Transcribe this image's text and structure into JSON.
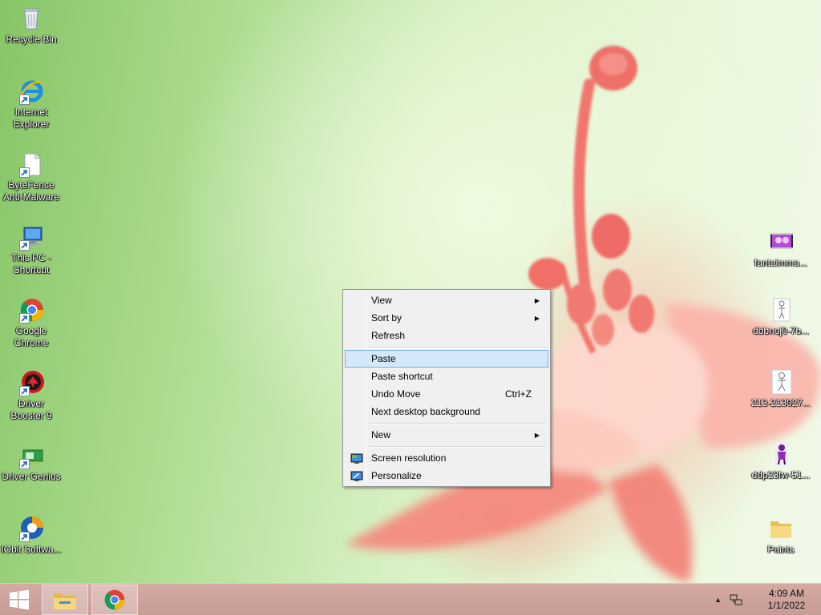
{
  "desktop": {
    "left_icons": [
      {
        "name": "recycle-bin",
        "label": "Recycle Bin",
        "icon": "recycle-bin-icon"
      },
      {
        "name": "internet-explorer",
        "label": "Internet Explorer",
        "icon": "internet-explorer-icon"
      },
      {
        "name": "bytefence",
        "label": "ByteFence Anti-Malware",
        "icon": "bytefence-icon"
      },
      {
        "name": "this-pc",
        "label": "This PC - Shortcut",
        "icon": "computer-icon"
      },
      {
        "name": "google-chrome",
        "label": "Google Chrome",
        "icon": "chrome-icon"
      },
      {
        "name": "driver-booster",
        "label": "Driver Booster 9",
        "icon": "driver-booster-icon"
      },
      {
        "name": "driver-genius",
        "label": "Driver Genius",
        "icon": "driver-genius-icon"
      },
      {
        "name": "iobit-software",
        "label": "IObit Softwa...",
        "icon": "iobit-icon"
      }
    ],
    "right_icons": [
      {
        "name": "fantaimma",
        "label": "fantaimma...",
        "icon": "image-file-icon"
      },
      {
        "name": "dbbnoj",
        "label": "dbbnoj0-7b...",
        "icon": "image-file-icon"
      },
      {
        "name": "213",
        "label": "213-213027...",
        "icon": "image-file-icon"
      },
      {
        "name": "ddp23fw",
        "label": "ddp23fw-51...",
        "icon": "image-file-icon"
      },
      {
        "name": "paints",
        "label": "Paints",
        "icon": "folder-icon"
      }
    ]
  },
  "context_menu": {
    "view": "View",
    "sort_by": "Sort by",
    "refresh": "Refresh",
    "paste": "Paste",
    "paste_shortcut": "Paste shortcut",
    "undo_move": "Undo Move",
    "undo_shortcut": "Ctrl+Z",
    "next_background": "Next desktop background",
    "new": "New",
    "screen_resolution": "Screen resolution",
    "personalize": "Personalize",
    "submenu_arrow": "▶",
    "highlighted": "Paste"
  },
  "taskbar": {
    "pinned": [
      "file-explorer",
      "google-chrome"
    ],
    "tray_chevron": "▲",
    "time": "4:09 AM",
    "date": "1/1/2022",
    "color": "#c9a099"
  }
}
